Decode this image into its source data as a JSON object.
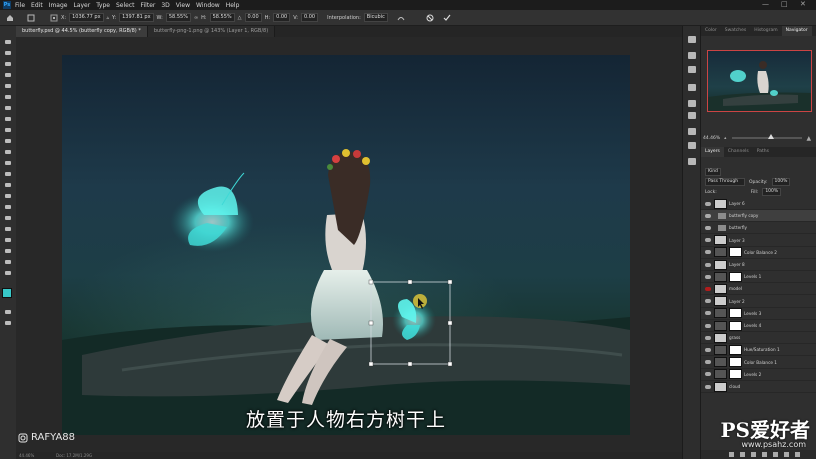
{
  "menu": {
    "app_icon": "Ps",
    "items": [
      "File",
      "Edit",
      "Image",
      "Layer",
      "Type",
      "Select",
      "Filter",
      "3D",
      "View",
      "Window",
      "Help"
    ],
    "window_controls": [
      "—",
      "□",
      "✕"
    ]
  },
  "options": {
    "x_value": "1036.77 px",
    "y_value": "1397.81 px",
    "w_label": "W:",
    "w_value": "58.55%",
    "h_label": "H:",
    "h_value": "58.55%",
    "angle_value": "0.00",
    "h2_label": "H:",
    "h2_value": "0.00",
    "v_label": "V:",
    "v_value": "0.00",
    "interpolation_label": "Interpolation:",
    "interpolation_value": "Bicubic",
    "cancel_icon": "cancel-icon",
    "commit_icon": "check-icon"
  },
  "tabs": [
    {
      "label": "butterfly.psd @ 44.5% (butterfly copy, RGB/8) *",
      "active": true
    },
    {
      "label": "butterfly-png-1.png @ 143% (Layer 1, RGB/8)",
      "active": false
    }
  ],
  "canvas": {
    "caption": "放置于人物右方树干上",
    "watermark_handle": "RAFYA88"
  },
  "status": {
    "zoom": "44.46%",
    "doc": "Doc: 17.2M/1.29G"
  },
  "panels": {
    "top_tabs": [
      "Color",
      "Swatches",
      "Histogram",
      "Navigator"
    ],
    "active_top_tab": "Navigator",
    "nav_zoom": "44.46%",
    "nav_zoom_fraction": 0.55,
    "layer_tabs": [
      "Layers",
      "Channels",
      "Paths"
    ],
    "active_layer_tab": "Layers",
    "kind_label": "Kind",
    "blend_mode": "Pass Through",
    "opacity_label": "Opacity:",
    "opacity_value": "100%",
    "lock_label": "Lock:",
    "fill_label": "Fill:",
    "fill_value": "100%",
    "layers": [
      {
        "name": "Layer 6",
        "kind": "thumb"
      },
      {
        "name": "butterfly copy",
        "kind": "folder",
        "selected": true
      },
      {
        "name": "butterfly",
        "kind": "folder"
      },
      {
        "name": "Layer 3",
        "kind": "thumb"
      },
      {
        "name": "Color Balance 2",
        "kind": "adj"
      },
      {
        "name": "Layer 8",
        "kind": "thumb"
      },
      {
        "name": "Levels 1",
        "kind": "adj"
      },
      {
        "name": "model",
        "kind": "thumb",
        "red_eye": true
      },
      {
        "name": "Layer 2",
        "kind": "thumb"
      },
      {
        "name": "Levels 3",
        "kind": "adj"
      },
      {
        "name": "Levels 4",
        "kind": "adj"
      },
      {
        "name": "grass",
        "kind": "thumb"
      },
      {
        "name": "Hue/Saturation 1",
        "kind": "adj"
      },
      {
        "name": "Color Balance 1",
        "kind": "adj"
      },
      {
        "name": "Levels 2",
        "kind": "adj"
      },
      {
        "name": "cloud",
        "kind": "thumb"
      }
    ]
  },
  "site_watermark": {
    "logo": "PS爱好者",
    "url": "www.psahz.com"
  },
  "colors": {
    "foreground": "#38c9c9",
    "background": "#ffffff",
    "butterfly_glow": "#5ff6ee"
  }
}
